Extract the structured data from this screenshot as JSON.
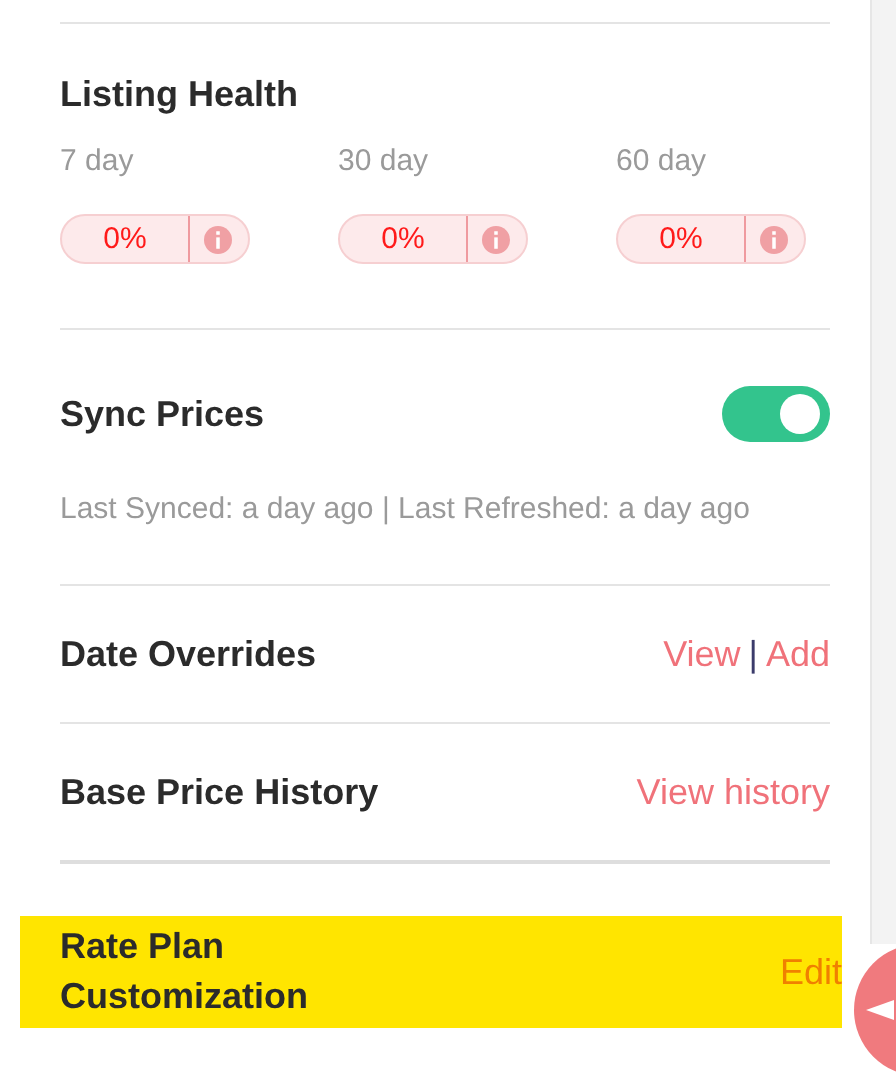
{
  "listing_health": {
    "title": "Listing Health",
    "periods": [
      {
        "label": "7 day",
        "value": "0%"
      },
      {
        "label": "30 day",
        "value": "0%"
      },
      {
        "label": "60 day",
        "value": "0%"
      }
    ]
  },
  "sync_prices": {
    "title": "Sync Prices",
    "on": true,
    "status": "Last Synced: a day ago | Last Refreshed: a day ago"
  },
  "rows": [
    {
      "title": "Date Overrides",
      "highlighted": false,
      "actions": [
        "View",
        "Add"
      ],
      "separator": "|"
    },
    {
      "title": "Base Price History",
      "highlighted": false,
      "actions": [
        "View history"
      ]
    },
    {
      "title": "Rate Plan Customization",
      "highlighted": true,
      "actions": [
        "Edit"
      ]
    }
  ]
}
